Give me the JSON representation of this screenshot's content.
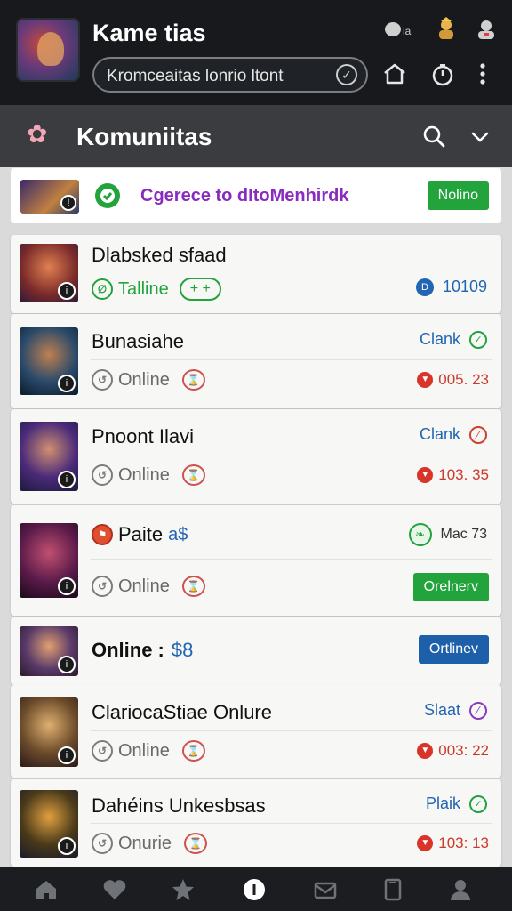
{
  "header": {
    "app_title": "Kame tias",
    "search_text": "Kromceaitas Ɩonrio Ɩtont",
    "icon_right_label": "ia"
  },
  "section": {
    "title": "Komuniitas"
  },
  "banner": {
    "text": "Cgerece to dItoMenhirdk",
    "button": "Nolino"
  },
  "items": [
    {
      "name": "Dlabsked sfaad",
      "status": "Talline",
      "tag": "+ +",
      "right_label": "10109",
      "kind": "online-tag"
    },
    {
      "name": "Bunasiahe",
      "status": "Online",
      "right_label": "Clank",
      "time": "005. 23",
      "kind": "clank-ok"
    },
    {
      "name": "Pnoont Ilavi",
      "status": "Online",
      "right_label": "Clank",
      "time": "103. 35",
      "kind": "clank-no"
    },
    {
      "name": "Paite",
      "name_extra": "a$",
      "status": "Online",
      "right_label": "Mac 73",
      "button": "Orelnerv",
      "kind": "green-btn"
    },
    {
      "name": "Online :",
      "name_extra": "$8",
      "button": "Ortlinev",
      "kind": "blue-btn"
    },
    {
      "name": "ClariocaStiae Onlure",
      "status": "Online",
      "right_label": "Slaat",
      "time": "003: 22",
      "kind": "slaat"
    },
    {
      "name": "Dahéins Unkesbsas",
      "status": "Onurie",
      "right_label": "Plaik",
      "time": "103: 13",
      "kind": "plaik"
    }
  ],
  "colors": {
    "header_bg": "#17191c",
    "section_bg": "#3a3c40",
    "accent_green": "#22a33c",
    "accent_blue": "#1d5fa8",
    "banner_text": "#8a2bbf"
  }
}
